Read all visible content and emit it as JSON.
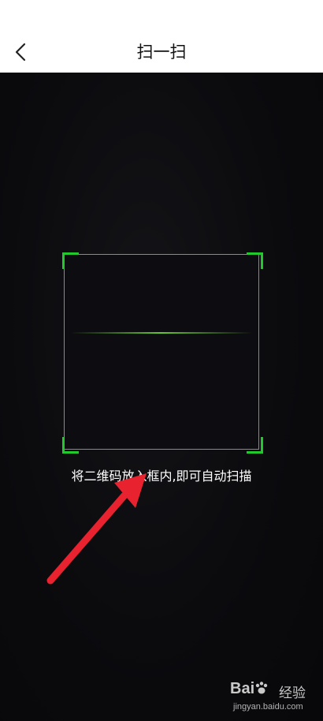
{
  "header": {
    "title": "扫一扫",
    "back_icon": "chevron-left-icon"
  },
  "scanner": {
    "hint": "将二维码放入框内,即可自动扫描",
    "corner_color": "#22c92c",
    "scan_line_color": "#6edc32"
  },
  "annotation": {
    "arrow_color": "#e8232f"
  },
  "watermark": {
    "logo_left": "Bai",
    "logo_right": "经验",
    "url": "jingyan.baidu.com"
  }
}
